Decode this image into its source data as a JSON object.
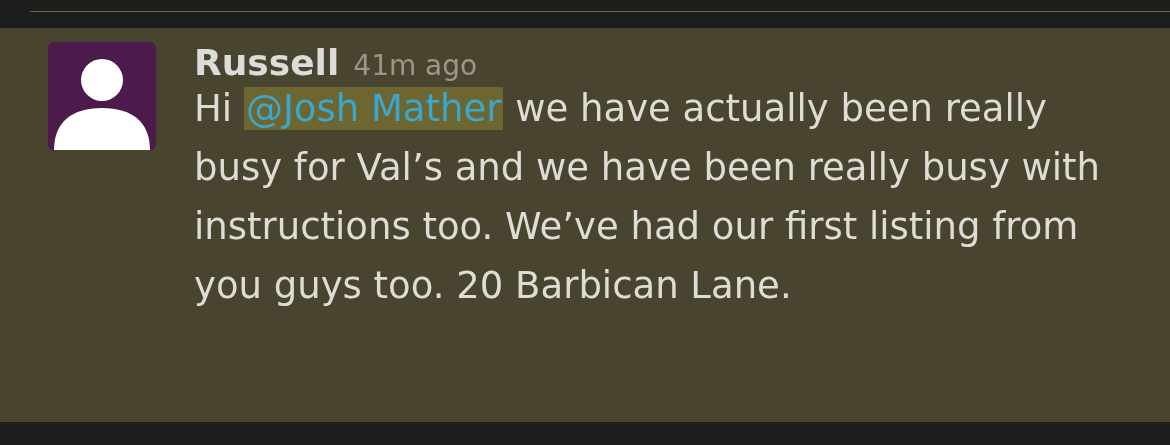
{
  "message": {
    "author": "Russell",
    "time": "41m ago",
    "text_before": "Hi",
    "mention": "@Josh Mather",
    "text_after": "we have actually been really busy for Val’s and we have been really busy with instructions too. We’ve had our first listing from you guys too. 20 Barbican Lane."
  }
}
